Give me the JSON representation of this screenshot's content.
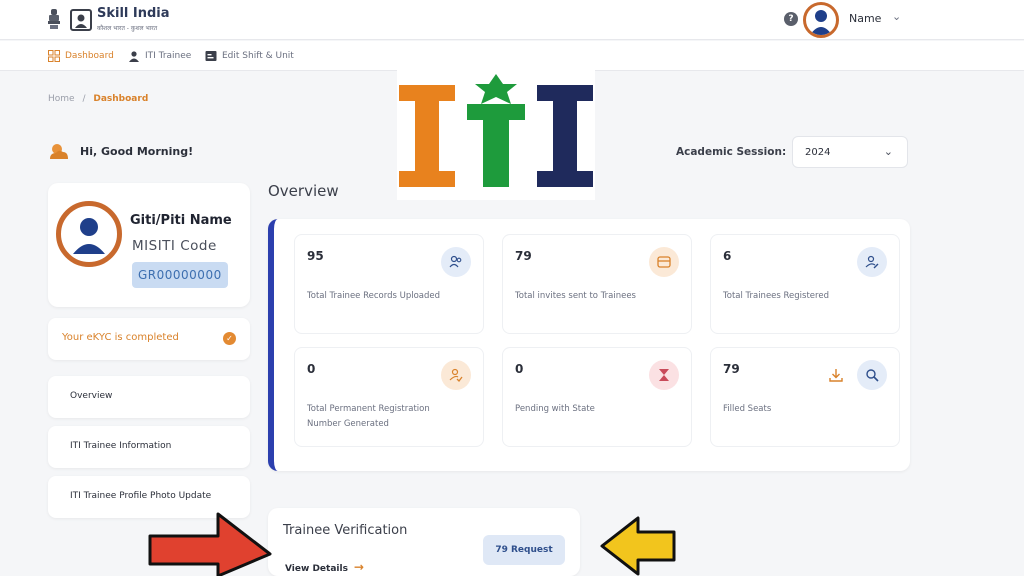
{
  "header": {
    "brand_title": "Skill India",
    "brand_tagline": "कौशल भारत - कुशल भारत",
    "help_symbol": "?",
    "user_name": "Name",
    "user_chevron": "⌄"
  },
  "subnav": {
    "items": [
      {
        "label": "Dashboard",
        "icon": "grid-icon"
      },
      {
        "label": "ITI Trainee",
        "icon": "trainee-icon"
      },
      {
        "label": "Edit Shift & Unit",
        "icon": "edit-icon"
      }
    ]
  },
  "breadcrumb": {
    "home": "Home",
    "separator": "/",
    "current": "Dashboard"
  },
  "greeting": "Hi, Good Morning!",
  "session": {
    "label": "Academic Session:",
    "value": "2024",
    "chevron": "⌄"
  },
  "profile": {
    "name": "Giti/Piti  Name",
    "code_label": "MISITI Code",
    "id": "GR00000000"
  },
  "ekyc": {
    "text": "Your eKYC is completed",
    "tick": "✓"
  },
  "sidebar": {
    "items": [
      {
        "label": "Overview"
      },
      {
        "label": "ITI Trainee Information"
      },
      {
        "label": "ITI Trainee Profile Photo Update"
      }
    ]
  },
  "overview": {
    "title": "Overview",
    "stats": [
      {
        "value": "95",
        "label": "Total Trainee Records Uploaded",
        "icon": "users-icon"
      },
      {
        "value": "79",
        "label": "Total invites sent to Trainees",
        "icon": "mail-icon"
      },
      {
        "value": "6",
        "label": "Total Trainees Registered",
        "icon": "user-edit-icon"
      },
      {
        "value": "0",
        "label": "Total Permanent Registration Number Generated",
        "icon": "user-check-icon"
      },
      {
        "value": "0",
        "label": "Pending with State",
        "icon": "hourglass-icon"
      },
      {
        "value": "79",
        "label": "Filled Seats",
        "icon": "search-icon"
      }
    ]
  },
  "logo_overlay": {
    "text": "ITI",
    "colors": [
      "#e8821e",
      "#1e9b3c",
      "#1f2a5c"
    ]
  },
  "verification": {
    "title": "Trainee Verification",
    "link": "View Details",
    "link_arrow": "→",
    "request_count": "79 Request"
  },
  "colors": {
    "accent": "#d9822b",
    "primary": "#2c3fae",
    "avatar_ring": "#c8692d"
  }
}
